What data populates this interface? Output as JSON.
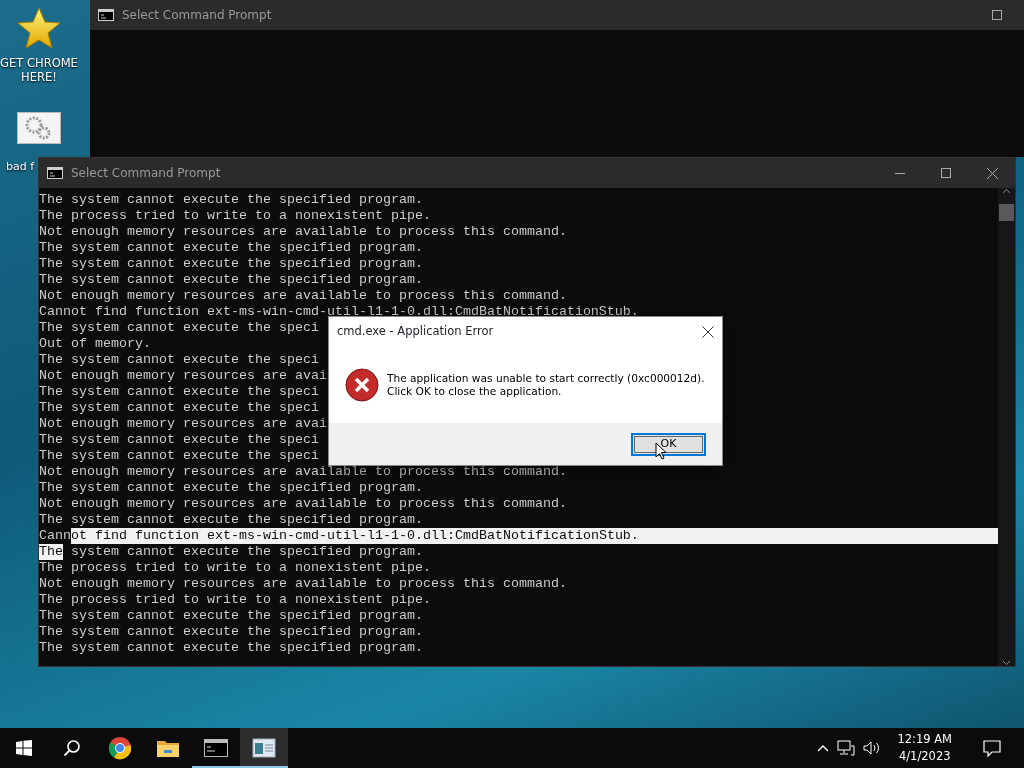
{
  "desktop_icons": [
    {
      "kind": "star",
      "label": "GET CHROME HERE!"
    },
    {
      "kind": "gears",
      "label": "bad f"
    }
  ],
  "back_window": {
    "title": "Select Command Prompt"
  },
  "console_window": {
    "title": "Select Command Prompt",
    "lines": [
      {
        "parts": [
          {
            "text": "The system cannot execute the specified program.",
            "selected": false
          }
        ]
      },
      {
        "parts": [
          {
            "text": "The process tried to write to a nonexistent pipe.",
            "selected": false
          }
        ]
      },
      {
        "parts": [
          {
            "text": "Not enough memory resources are available to process this command.",
            "selected": false
          }
        ]
      },
      {
        "parts": [
          {
            "text": "The system cannot execute the specified program.",
            "selected": false
          }
        ]
      },
      {
        "parts": [
          {
            "text": "The system cannot execute the specified program.",
            "selected": false
          }
        ]
      },
      {
        "parts": [
          {
            "text": "The system cannot execute the specified program.",
            "selected": false
          }
        ]
      },
      {
        "parts": [
          {
            "text": "Not enough memory resources are available to process this command.",
            "selected": false
          }
        ]
      },
      {
        "parts": [
          {
            "text": "Cannot find function ext-ms-win-cmd-util-l1-1-0.dll:CmdBatNotificationStub.",
            "selected": false
          }
        ]
      },
      {
        "parts": [
          {
            "text": "The system cannot execute the speci",
            "selected": false
          }
        ]
      },
      {
        "parts": [
          {
            "text": "Out of memory.",
            "selected": false
          }
        ]
      },
      {
        "parts": [
          {
            "text": "The system cannot execute the speci",
            "selected": false
          }
        ]
      },
      {
        "parts": [
          {
            "text": "Not enough memory resources are avai",
            "selected": false
          }
        ]
      },
      {
        "parts": [
          {
            "text": "The system cannot execute the speci",
            "selected": false
          }
        ]
      },
      {
        "parts": [
          {
            "text": "The system cannot execute the speci",
            "selected": false
          }
        ]
      },
      {
        "parts": [
          {
            "text": "Not enough memory resources are avai",
            "selected": false
          }
        ]
      },
      {
        "parts": [
          {
            "text": "The system cannot execute the speci",
            "selected": false
          }
        ]
      },
      {
        "parts": [
          {
            "text": "The system cannot execute the speci",
            "selected": false
          }
        ]
      },
      {
        "parts": [
          {
            "text": "Not enough memory resources are available to process this command.",
            "selected": false
          }
        ]
      },
      {
        "parts": [
          {
            "text": "The system cannot execute the specified program.",
            "selected": false
          }
        ]
      },
      {
        "parts": [
          {
            "text": "Not enough memory resources are available to process this command.",
            "selected": false
          }
        ]
      },
      {
        "parts": [
          {
            "text": "The system cannot execute the specified program.",
            "selected": false
          }
        ]
      },
      {
        "parts": [
          {
            "text": "Cann",
            "selected": false
          },
          {
            "text": "ot find function ext-ms-win-cmd-util-l1-1-0.dll:CmdBatNotificationStub.",
            "selected": true
          }
        ]
      },
      {
        "parts": [
          {
            "text": "The",
            "selected": true
          },
          {
            "text": " system cannot execute the specified program.",
            "selected": false
          }
        ]
      },
      {
        "parts": [
          {
            "text": "The process tried to write to a nonexistent pipe.",
            "selected": false
          }
        ]
      },
      {
        "parts": [
          {
            "text": "Not enough memory resources are available to process this command.",
            "selected": false
          }
        ]
      },
      {
        "parts": [
          {
            "text": "The process tried to write to a nonexistent pipe.",
            "selected": false
          }
        ]
      },
      {
        "parts": [
          {
            "text": "The system cannot execute the specified program.",
            "selected": false
          }
        ]
      },
      {
        "parts": [
          {
            "text": "The system cannot execute the specified program.",
            "selected": false
          }
        ]
      },
      {
        "parts": [
          {
            "text": "The system cannot execute the specified program.",
            "selected": false
          }
        ]
      }
    ]
  },
  "dialog": {
    "title": "cmd.exe - Application Error",
    "message": [
      "The application was unable to start correctly (0xc000012d).",
      "Click OK to close the application."
    ],
    "button": "OK"
  },
  "taskbar": {
    "apps": [
      {
        "kind": "browser",
        "running": false,
        "selected": false
      },
      {
        "kind": "folder",
        "running": false,
        "selected": false
      },
      {
        "kind": "console",
        "running": true,
        "selected": false
      },
      {
        "kind": "appwindow",
        "running": true,
        "selected": true
      }
    ],
    "time": "12:19 AM",
    "date": "4/1/2023"
  }
}
